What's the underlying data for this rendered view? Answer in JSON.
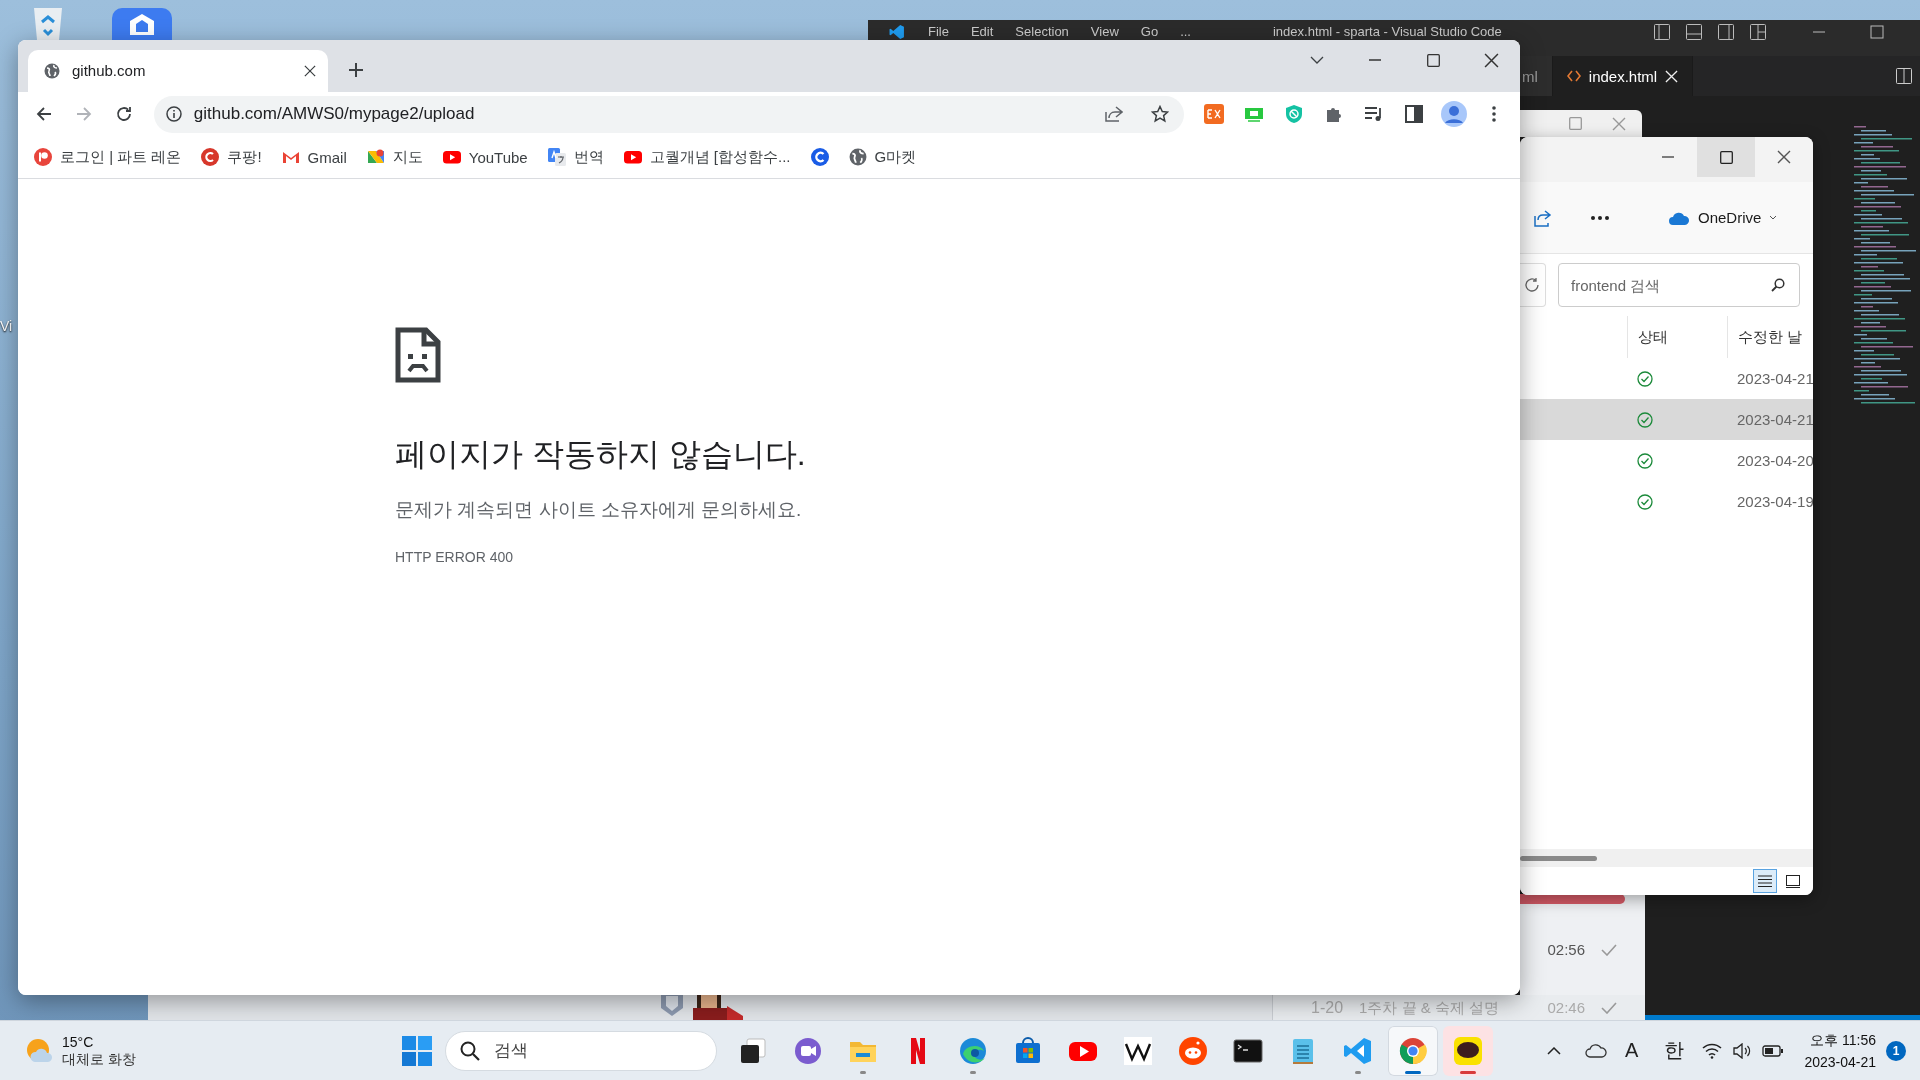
{
  "desktop": {
    "labels": [
      "Vi"
    ]
  },
  "vscode": {
    "menu": [
      "File",
      "Edit",
      "Selection",
      "View",
      "Go",
      "..."
    ],
    "title": "index.html - sparta - Visual Studio Code",
    "tabs": [
      {
        "label": "ml",
        "selected": false
      },
      {
        "label": "index.html",
        "selected": true
      }
    ]
  },
  "lesson_window": {
    "rows": [
      {
        "time": "02:56"
      },
      {
        "number": "1-20",
        "title": "1주차 끝 & 숙제 설명",
        "time": "02:46"
      }
    ]
  },
  "explorer": {
    "location": "OneDrive",
    "search": {
      "placeholder": "frontend 검색"
    },
    "columns": [
      "상태",
      "수정한 날"
    ],
    "rows": [
      {
        "date": "2023-04-21",
        "selected": false
      },
      {
        "date": "2023-04-21",
        "selected": true
      },
      {
        "date": "2023-04-20",
        "selected": false
      },
      {
        "date": "2023-04-19",
        "selected": false
      }
    ]
  },
  "browser": {
    "tabs": [
      {
        "title": "github.com",
        "selected": true
      }
    ],
    "address": "github.com/AMWS0/mypage2/upload",
    "bookmarks": [
      {
        "kind": "patreon",
        "label": "로그인 | 파트 레온"
      },
      {
        "kind": "coupang",
        "label": "쿠팡!"
      },
      {
        "kind": "gmail",
        "label": "Gmail"
      },
      {
        "kind": "maps",
        "label": "지도"
      },
      {
        "kind": "youtube",
        "label": "YouTube"
      },
      {
        "kind": "translate",
        "label": "번역"
      },
      {
        "kind": "youtube",
        "label": "고퀄개념 [합성함수..."
      },
      {
        "kind": "cblue"
      },
      {
        "kind": "globe",
        "label": "G마켓"
      }
    ],
    "error": {
      "title": "페이지가 작동하지 않습니다.",
      "message": "문제가 계속되면 사이트 소유자에게 문의하세요.",
      "code": "HTTP ERROR 400"
    }
  },
  "taskbar": {
    "weather": {
      "temperature": "15°C",
      "condition": "대체로 화창"
    },
    "search": {
      "placeholder": "검색"
    },
    "apps": [
      {
        "kind": "taskview",
        "running": false,
        "selected": false,
        "flashing": false
      },
      {
        "kind": "chat",
        "running": false,
        "selected": false,
        "flashing": false
      },
      {
        "kind": "files",
        "running": true,
        "selected": false,
        "flashing": false
      },
      {
        "kind": "netflix",
        "running": false,
        "selected": false,
        "flashing": false
      },
      {
        "kind": "edge",
        "running": true,
        "selected": false,
        "flashing": false
      },
      {
        "kind": "store",
        "running": false,
        "selected": false,
        "flashing": false
      },
      {
        "kind": "youtube",
        "running": false,
        "selected": false,
        "flashing": false
      },
      {
        "kind": "wiki",
        "running": false,
        "selected": false,
        "flashing": false
      },
      {
        "kind": "reddit",
        "running": false,
        "selected": false,
        "flashing": false
      },
      {
        "kind": "terminal",
        "running": false,
        "selected": false,
        "flashing": false
      },
      {
        "kind": "notepad",
        "running": false,
        "selected": false,
        "flashing": false
      },
      {
        "kind": "vscode",
        "running": true,
        "selected": false,
        "flashing": false
      },
      {
        "kind": "chrome",
        "running": true,
        "selected": true,
        "flashing": false
      },
      {
        "kind": "kakao",
        "running": true,
        "selected": false,
        "flashing": true
      }
    ],
    "tray": {
      "input_mode": "A",
      "language": "한"
    },
    "clock": {
      "time": "오후 11:56",
      "date": "2023-04-21"
    },
    "notifications": "1"
  }
}
